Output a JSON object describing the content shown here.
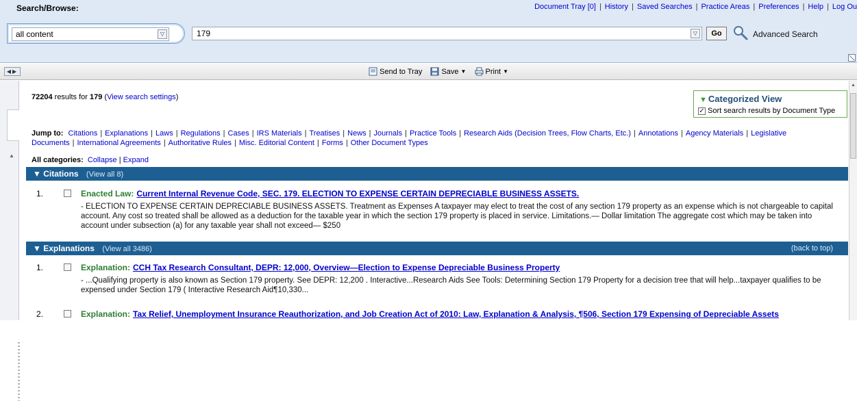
{
  "search_panel": {
    "title": "Search/Browse:",
    "top_links": [
      "Document Tray [0]",
      "History",
      "Saved Searches",
      "Practice Areas",
      "Preferences",
      "Help",
      "Log Ou"
    ],
    "scope_value": "all content",
    "query_value": "179",
    "go_label": "Go",
    "advanced_label": "Advanced Search"
  },
  "toolbar": {
    "send_label": "Send to Tray",
    "save_label": "Save",
    "print_label": "Print"
  },
  "results": {
    "count": "72204",
    "results_for_text": " results for ",
    "query": "179",
    "settings_link": "View search settings"
  },
  "categorized": {
    "title": "Categorized View",
    "sort_label": "Sort search results by Document Type"
  },
  "jump": {
    "label": "Jump to:",
    "links": [
      "Citations",
      "Explanations",
      "Laws",
      "Regulations",
      "Cases",
      "IRS Materials",
      "Treatises",
      "News",
      "Journals",
      "Practice Tools",
      "Research Aids (Decision Trees, Flow Charts, Etc.)",
      "Annotations",
      "Agency Materials",
      "Legislative Documents",
      "International Agreements",
      "Authoritative Rules",
      "Misc. Editorial Content",
      "Forms",
      "Other Document Types"
    ]
  },
  "all_categories": {
    "label": "All categories:",
    "collapse": "Collapse",
    "expand": "Expand"
  },
  "sections": [
    {
      "name": "Citations",
      "view_all": "View all 8",
      "back_to_top": "",
      "results": [
        {
          "num": "1.",
          "type": "Enacted Law:",
          "title": "Current Internal Revenue Code, SEC. 179. ELECTION TO EXPENSE CERTAIN DEPRECIABLE BUSINESS ASSETS.",
          "snippet": "- ELECTION TO EXPENSE CERTAIN DEPRECIABLE BUSINESS ASSETS. Treatment as Expenses A taxpayer may elect to treat the cost of any section 179 property as an expense which is not chargeable to capital account. Any cost so treated shall be allowed as a deduction for the taxable year in which the section 179 property is placed in service. Limitations.— Dollar limitation The aggregate cost which may be taken into account under subsection (a) for any taxable year shall not exceed— $250"
        }
      ]
    },
    {
      "name": "Explanations",
      "view_all": "View all 3486",
      "back_to_top": "(back to top)",
      "results": [
        {
          "num": "1.",
          "type": "Explanation:",
          "title": "CCH Tax Research Consultant, DEPR: 12,000, Overview—Election to Expense Depreciable Business Property",
          "snippet": "- ...Qualifying property is also known as Section 179 property. See DEPR: 12,200 . Interactive...Research Aids See Tools: Determining Section 179 Property for a decision tree that will help...taxpayer qualifies to be expensed under Section 179 ( Interactive Research Aid¶10,330..."
        },
        {
          "num": "2.",
          "type": "Explanation:",
          "title": "Tax Relief, Unemployment Insurance Reauthorization, and Job Creation Act of 2010: Law, Explanation & Analysis, ¶506, Section 179 Expensing of Depreciable Assets",
          "snippet": ""
        }
      ]
    }
  ],
  "colors": {
    "section_bar": "#1d5f93",
    "link": "#0000cc",
    "doc_type": "#2e7d32",
    "panel_bg": "#dfe9f5",
    "categorized_border": "#6aa84f"
  }
}
